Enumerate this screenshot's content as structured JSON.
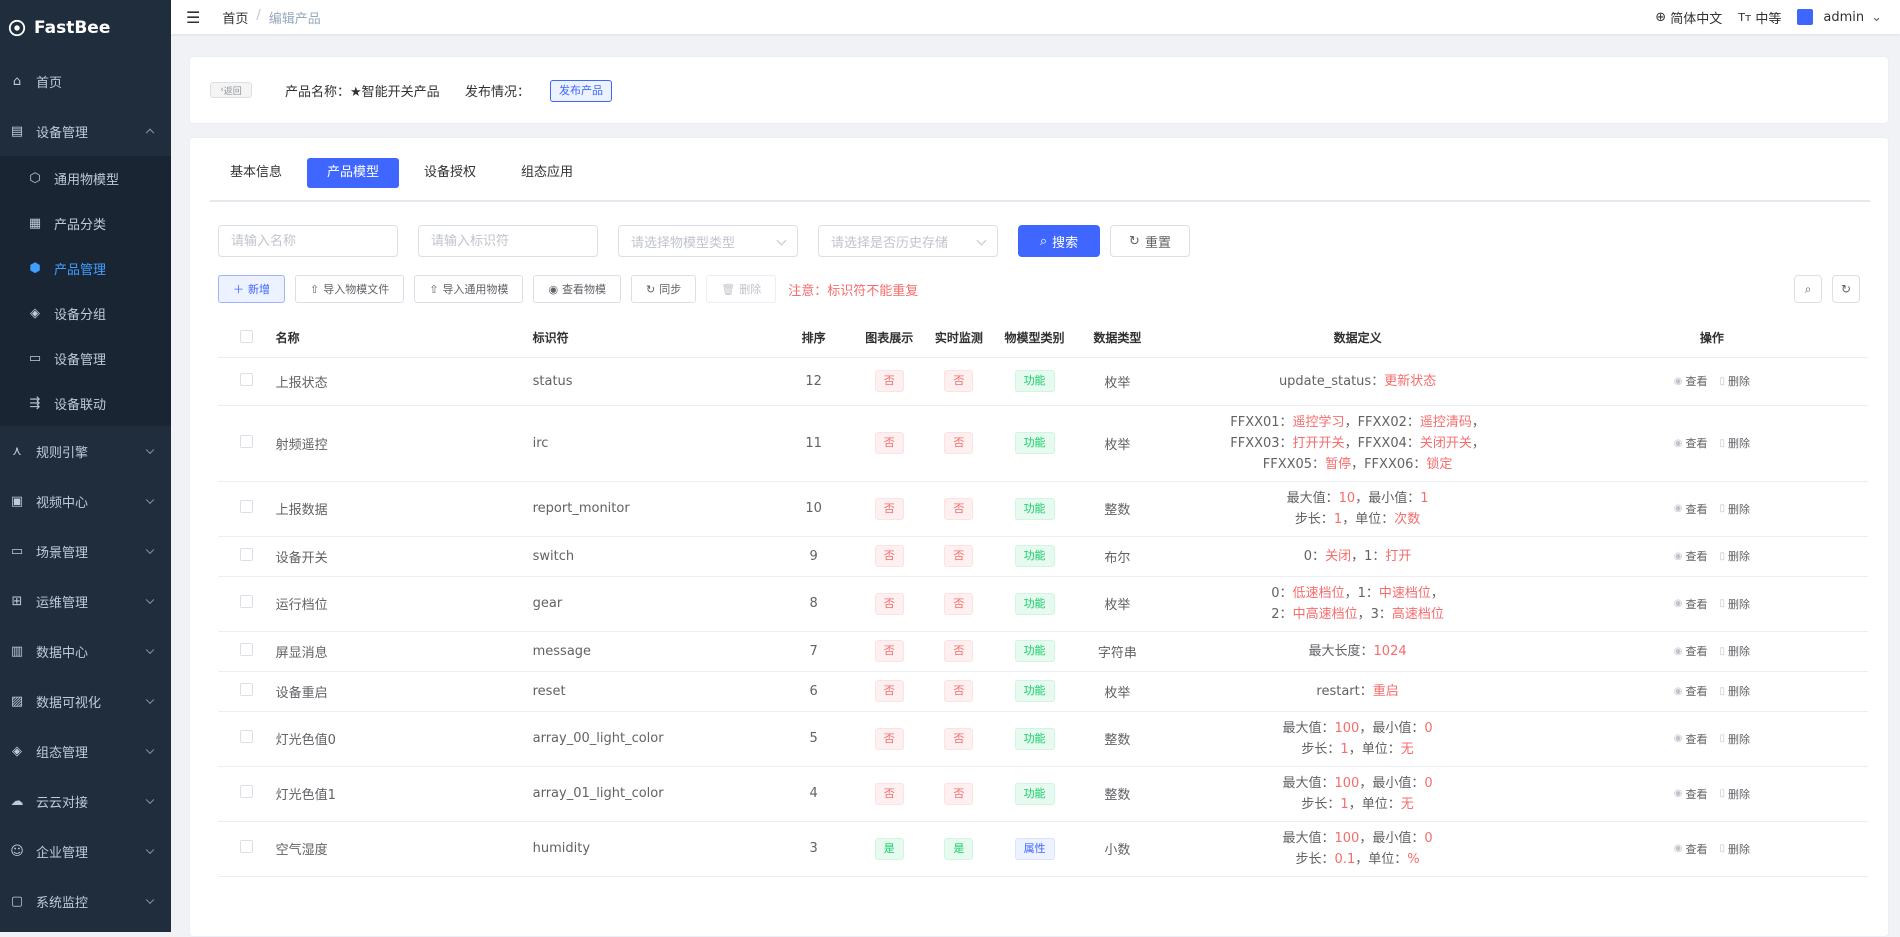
{
  "app": {
    "name": "FastBee"
  },
  "sidebar": {
    "items": [
      {
        "label": "首页",
        "icon": "home-icon"
      },
      {
        "label": "设备管理",
        "icon": "list-icon",
        "expanded": true,
        "children": [
          {
            "label": "通用物模型",
            "icon": "model-icon"
          },
          {
            "label": "产品分类",
            "icon": "grid-icon"
          },
          {
            "label": "产品管理",
            "icon": "product-icon",
            "active": true
          },
          {
            "label": "设备分组",
            "icon": "layers-icon"
          },
          {
            "label": "设备管理",
            "icon": "device-icon"
          },
          {
            "label": "设备联动",
            "icon": "link-icon"
          }
        ]
      },
      {
        "label": "规则引擎",
        "icon": "rule-icon"
      },
      {
        "label": "视频中心",
        "icon": "video-icon"
      },
      {
        "label": "场景管理",
        "icon": "scene-icon"
      },
      {
        "label": "运维管理",
        "icon": "ops-icon"
      },
      {
        "label": "数据中心",
        "icon": "chart-icon"
      },
      {
        "label": "数据可视化",
        "icon": "visual-icon"
      },
      {
        "label": "组态管理",
        "icon": "config-icon"
      },
      {
        "label": "云云对接",
        "icon": "cloud-icon"
      },
      {
        "label": "企业管理",
        "icon": "enterprise-icon"
      },
      {
        "label": "系统监控",
        "icon": "monitor-icon"
      }
    ]
  },
  "navbar": {
    "breadcrumb": [
      "首页",
      "编辑产品"
    ],
    "language": "简体中文",
    "font_size": "中等",
    "user": "admin"
  },
  "product": {
    "back_label": "返回",
    "name_label": "产品名称：",
    "name_value": "★智能开关产品",
    "publish_label": "发布情况：",
    "publish_button": "发布产品"
  },
  "tabs": [
    {
      "label": "基本信息"
    },
    {
      "label": "产品模型",
      "active": true
    },
    {
      "label": "设备授权"
    },
    {
      "label": "组态应用"
    }
  ],
  "filters": {
    "name_placeholder": "请输入名称",
    "id_placeholder": "请输入标识符",
    "type_placeholder": "请选择物模型类型",
    "history_placeholder": "请选择是否历史存储",
    "search_label": "搜索",
    "reset_label": "重置"
  },
  "toolbar": {
    "add": "新增",
    "import_file": "导入物模文件",
    "import_common": "导入通用物模",
    "view": "查看物模",
    "sync": "同步",
    "delete": "删除",
    "warning": "注意：标识符不能重复"
  },
  "table": {
    "headers": [
      "名称",
      "标识符",
      "排序",
      "图表展示",
      "实时监测",
      "物模型类别",
      "数据类型",
      "数据定义",
      "操作"
    ],
    "op_view": "查看",
    "op_delete": "删除",
    "rows": [
      {
        "name": "上报状态",
        "id": "status",
        "order": "12",
        "chart": "否",
        "monitor": "否",
        "category": "功能",
        "type": "枚举",
        "def": [
          [
            [
              "update_status：",
              ""
            ],
            [
              "更新状态",
              "red"
            ]
          ]
        ]
      },
      {
        "name": "射频遥控",
        "id": "irc",
        "order": "11",
        "chart": "否",
        "monitor": "否",
        "category": "功能",
        "type": "枚举",
        "def": [
          [
            [
              "FFXX01：",
              ""
            ],
            [
              "遥控学习",
              "red"
            ],
            [
              "，FFXX02：",
              ""
            ],
            [
              "遥控清码",
              "red"
            ],
            [
              "，",
              ""
            ]
          ],
          [
            [
              "FFXX03：",
              ""
            ],
            [
              "打开开关",
              "red"
            ],
            [
              "，FFXX04：",
              ""
            ],
            [
              "关闭开关",
              "red"
            ],
            [
              "，",
              ""
            ]
          ],
          [
            [
              "FFXX05：",
              ""
            ],
            [
              "暂停",
              "red"
            ],
            [
              "，FFXX06：",
              ""
            ],
            [
              "锁定",
              "red"
            ]
          ]
        ]
      },
      {
        "name": "上报数据",
        "id": "report_monitor",
        "order": "10",
        "chart": "否",
        "monitor": "否",
        "category": "功能",
        "type": "整数",
        "def": [
          [
            [
              "最大值：",
              ""
            ],
            [
              "10",
              "red"
            ],
            [
              "，最小值：",
              ""
            ],
            [
              "1",
              "red"
            ]
          ],
          [
            [
              "步长：",
              ""
            ],
            [
              "1",
              "red"
            ],
            [
              "，单位：",
              ""
            ],
            [
              "次数",
              "red"
            ]
          ]
        ]
      },
      {
        "name": "设备开关",
        "id": "switch",
        "order": "9",
        "chart": "否",
        "monitor": "否",
        "category": "功能",
        "type": "布尔",
        "def": [
          [
            [
              "0：",
              ""
            ],
            [
              "关闭",
              "red"
            ],
            [
              "，1：",
              ""
            ],
            [
              "打开",
              "red"
            ]
          ]
        ]
      },
      {
        "name": "运行档位",
        "id": "gear",
        "order": "8",
        "chart": "否",
        "monitor": "否",
        "category": "功能",
        "type": "枚举",
        "def": [
          [
            [
              "0：",
              ""
            ],
            [
              "低速档位",
              "red"
            ],
            [
              "，1：",
              ""
            ],
            [
              "中速档位",
              "red"
            ],
            [
              "，",
              ""
            ]
          ],
          [
            [
              "2：",
              ""
            ],
            [
              "中高速档位",
              "red"
            ],
            [
              "，3：",
              ""
            ],
            [
              "高速档位",
              "red"
            ]
          ]
        ]
      },
      {
        "name": "屏显消息",
        "id": "message",
        "order": "7",
        "chart": "否",
        "monitor": "否",
        "category": "功能",
        "type": "字符串",
        "def": [
          [
            [
              "最大长度：",
              ""
            ],
            [
              "1024",
              "red"
            ]
          ]
        ]
      },
      {
        "name": "设备重启",
        "id": "reset",
        "order": "6",
        "chart": "否",
        "monitor": "否",
        "category": "功能",
        "type": "枚举",
        "def": [
          [
            [
              "restart：",
              ""
            ],
            [
              "重启",
              "red"
            ]
          ]
        ]
      },
      {
        "name": "灯光色值0",
        "id": "array_00_light_color",
        "order": "5",
        "chart": "否",
        "monitor": "否",
        "category": "功能",
        "type": "整数",
        "def": [
          [
            [
              "最大值：",
              ""
            ],
            [
              "100",
              "red"
            ],
            [
              "，最小值：",
              ""
            ],
            [
              "0",
              "red"
            ]
          ],
          [
            [
              "步长：",
              ""
            ],
            [
              "1",
              "red"
            ],
            [
              "，单位：",
              ""
            ],
            [
              "无",
              "red"
            ]
          ]
        ]
      },
      {
        "name": "灯光色值1",
        "id": "array_01_light_color",
        "order": "4",
        "chart": "否",
        "monitor": "否",
        "category": "功能",
        "type": "整数",
        "def": [
          [
            [
              "最大值：",
              ""
            ],
            [
              "100",
              "red"
            ],
            [
              "，最小值：",
              ""
            ],
            [
              "0",
              "red"
            ]
          ],
          [
            [
              "步长：",
              ""
            ],
            [
              "1",
              "red"
            ],
            [
              "，单位：",
              ""
            ],
            [
              "无",
              "red"
            ]
          ]
        ]
      },
      {
        "name": "空气湿度",
        "id": "humidity",
        "order": "3",
        "chart": "是",
        "monitor": "是",
        "category": "属性",
        "type": "小数",
        "def": [
          [
            [
              "最大值：",
              ""
            ],
            [
              "100",
              "red"
            ],
            [
              "，最小值：",
              ""
            ],
            [
              "0",
              "red"
            ]
          ],
          [
            [
              "步长：",
              ""
            ],
            [
              "0.1",
              "red"
            ],
            [
              "，单位：",
              ""
            ],
            [
              "%",
              "red"
            ]
          ]
        ]
      }
    ]
  }
}
